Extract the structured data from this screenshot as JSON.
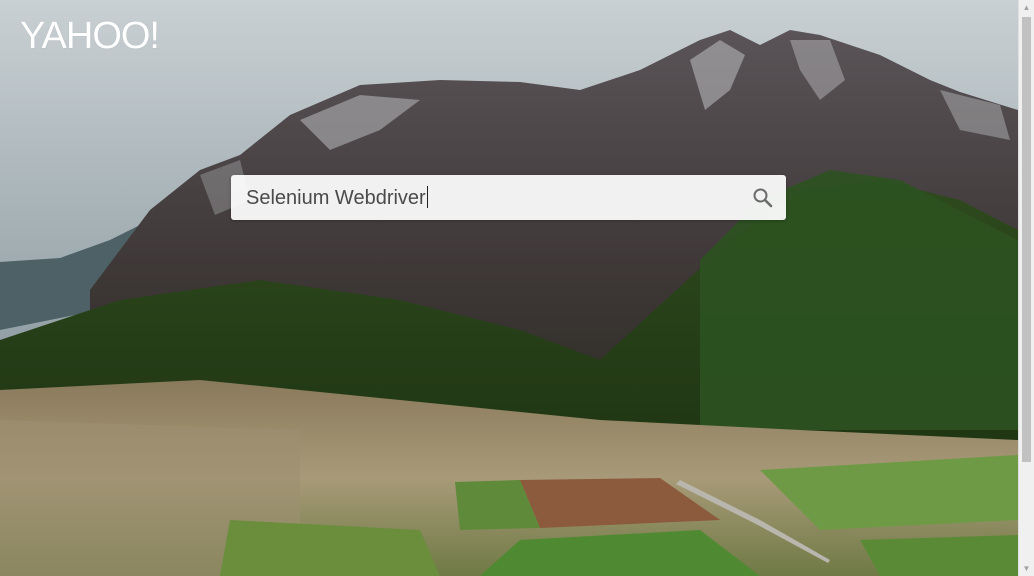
{
  "header": {
    "logo_text": "YAHOO!"
  },
  "search": {
    "value": "Selenium Webdriver",
    "placeholder": ""
  },
  "icons": {
    "search": "search-icon",
    "scroll_up": "arrow-up-icon",
    "scroll_down": "arrow-down-icon"
  },
  "colors": {
    "logo": "#ffffff",
    "search_bg": "#f5f5f5",
    "scrollbar_track": "#f0f0f0",
    "scrollbar_thumb": "#c1c1c1"
  }
}
